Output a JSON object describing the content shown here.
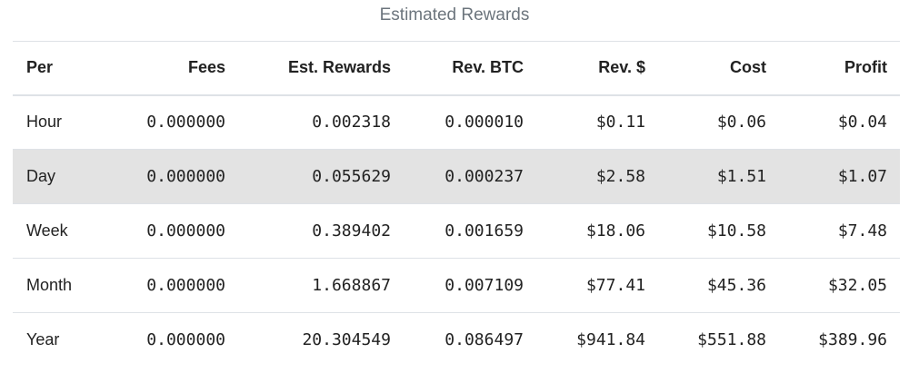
{
  "caption": "Estimated Rewards",
  "table": {
    "headers": [
      "Per",
      "Fees",
      "Est. Rewards",
      "Rev. BTC",
      "Rev. $",
      "Cost",
      "Profit"
    ],
    "rows": [
      {
        "per": "Hour",
        "fees": "0.000000",
        "est_rewards": "0.002318",
        "rev_btc": "0.000010",
        "rev_usd": "$0.11",
        "cost": "$0.06",
        "profit": "$0.04"
      },
      {
        "per": "Day",
        "fees": "0.000000",
        "est_rewards": "0.055629",
        "rev_btc": "0.000237",
        "rev_usd": "$2.58",
        "cost": "$1.51",
        "profit": "$1.07"
      },
      {
        "per": "Week",
        "fees": "0.000000",
        "est_rewards": "0.389402",
        "rev_btc": "0.001659",
        "rev_usd": "$18.06",
        "cost": "$10.58",
        "profit": "$7.48"
      },
      {
        "per": "Month",
        "fees": "0.000000",
        "est_rewards": "1.668867",
        "rev_btc": "0.007109",
        "rev_usd": "$77.41",
        "cost": "$45.36",
        "profit": "$32.05"
      },
      {
        "per": "Year",
        "fees": "0.000000",
        "est_rewards": "20.304549",
        "rev_btc": "0.086497",
        "rev_usd": "$941.84",
        "cost": "$551.88",
        "profit": "$389.96"
      }
    ]
  },
  "colors": {
    "caption_text": "#6c757d",
    "border": "#dee2e6",
    "hover_row": "#e3e3e3",
    "text": "#222222"
  }
}
